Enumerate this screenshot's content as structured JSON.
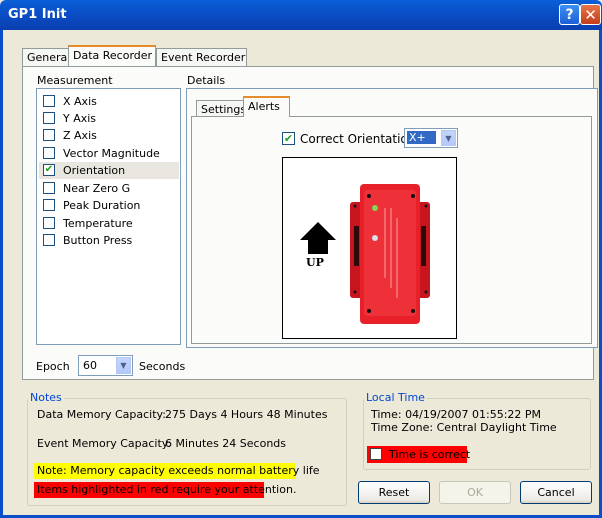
{
  "window": {
    "title": "GP1 Init",
    "help_glyph": "?",
    "close_glyph": "✕"
  },
  "tabs": [
    {
      "label": "General"
    },
    {
      "label": "Data Recorder"
    },
    {
      "label": "Event Recorder"
    }
  ],
  "measurement": {
    "heading": "Measurement",
    "items": [
      {
        "label": "X Axis",
        "checked": false
      },
      {
        "label": "Y Axis",
        "checked": false
      },
      {
        "label": "Z Axis",
        "checked": false
      },
      {
        "label": "Vector Magnitude",
        "checked": false
      },
      {
        "label": "Orientation",
        "checked": true
      },
      {
        "label": "Near Zero G",
        "checked": false
      },
      {
        "label": "Peak Duration",
        "checked": false
      },
      {
        "label": "Temperature",
        "checked": false
      },
      {
        "label": "Button Press",
        "checked": false
      }
    ]
  },
  "details": {
    "heading": "Details",
    "subtabs": [
      {
        "label": "Settings"
      },
      {
        "label": "Alerts"
      }
    ],
    "correct_orientation_label": "Correct Orientation",
    "orientation_value": "X+",
    "up_label": "UP"
  },
  "epoch": {
    "label": "Epoch",
    "value": "60",
    "unit": "Seconds"
  },
  "notes": {
    "heading": "Notes",
    "data_memory_label": "Data Memory Capacity:",
    "data_memory_value": "275 Days 4 Hours 48 Minutes",
    "event_memory_label": "Event Memory Capacity:",
    "event_memory_value": "6 Minutes 24 Seconds",
    "warning": "Note: Memory capacity exceeds normal battery life",
    "attention": "Items highlighted in red require your attention."
  },
  "local_time": {
    "heading": "Local Time",
    "time": "Time: 04/19/2007 01:55:22 PM",
    "zone": "Time Zone: Central Daylight Time",
    "confirm_label": "Time is correct"
  },
  "buttons": {
    "reset": "Reset",
    "ok": "OK",
    "cancel": "Cancel"
  },
  "colors": {
    "title_bar": "#0a4fc8",
    "highlight_red": "#ff0000",
    "highlight_yellow": "#ffff00",
    "device_red": "#e8202a"
  }
}
